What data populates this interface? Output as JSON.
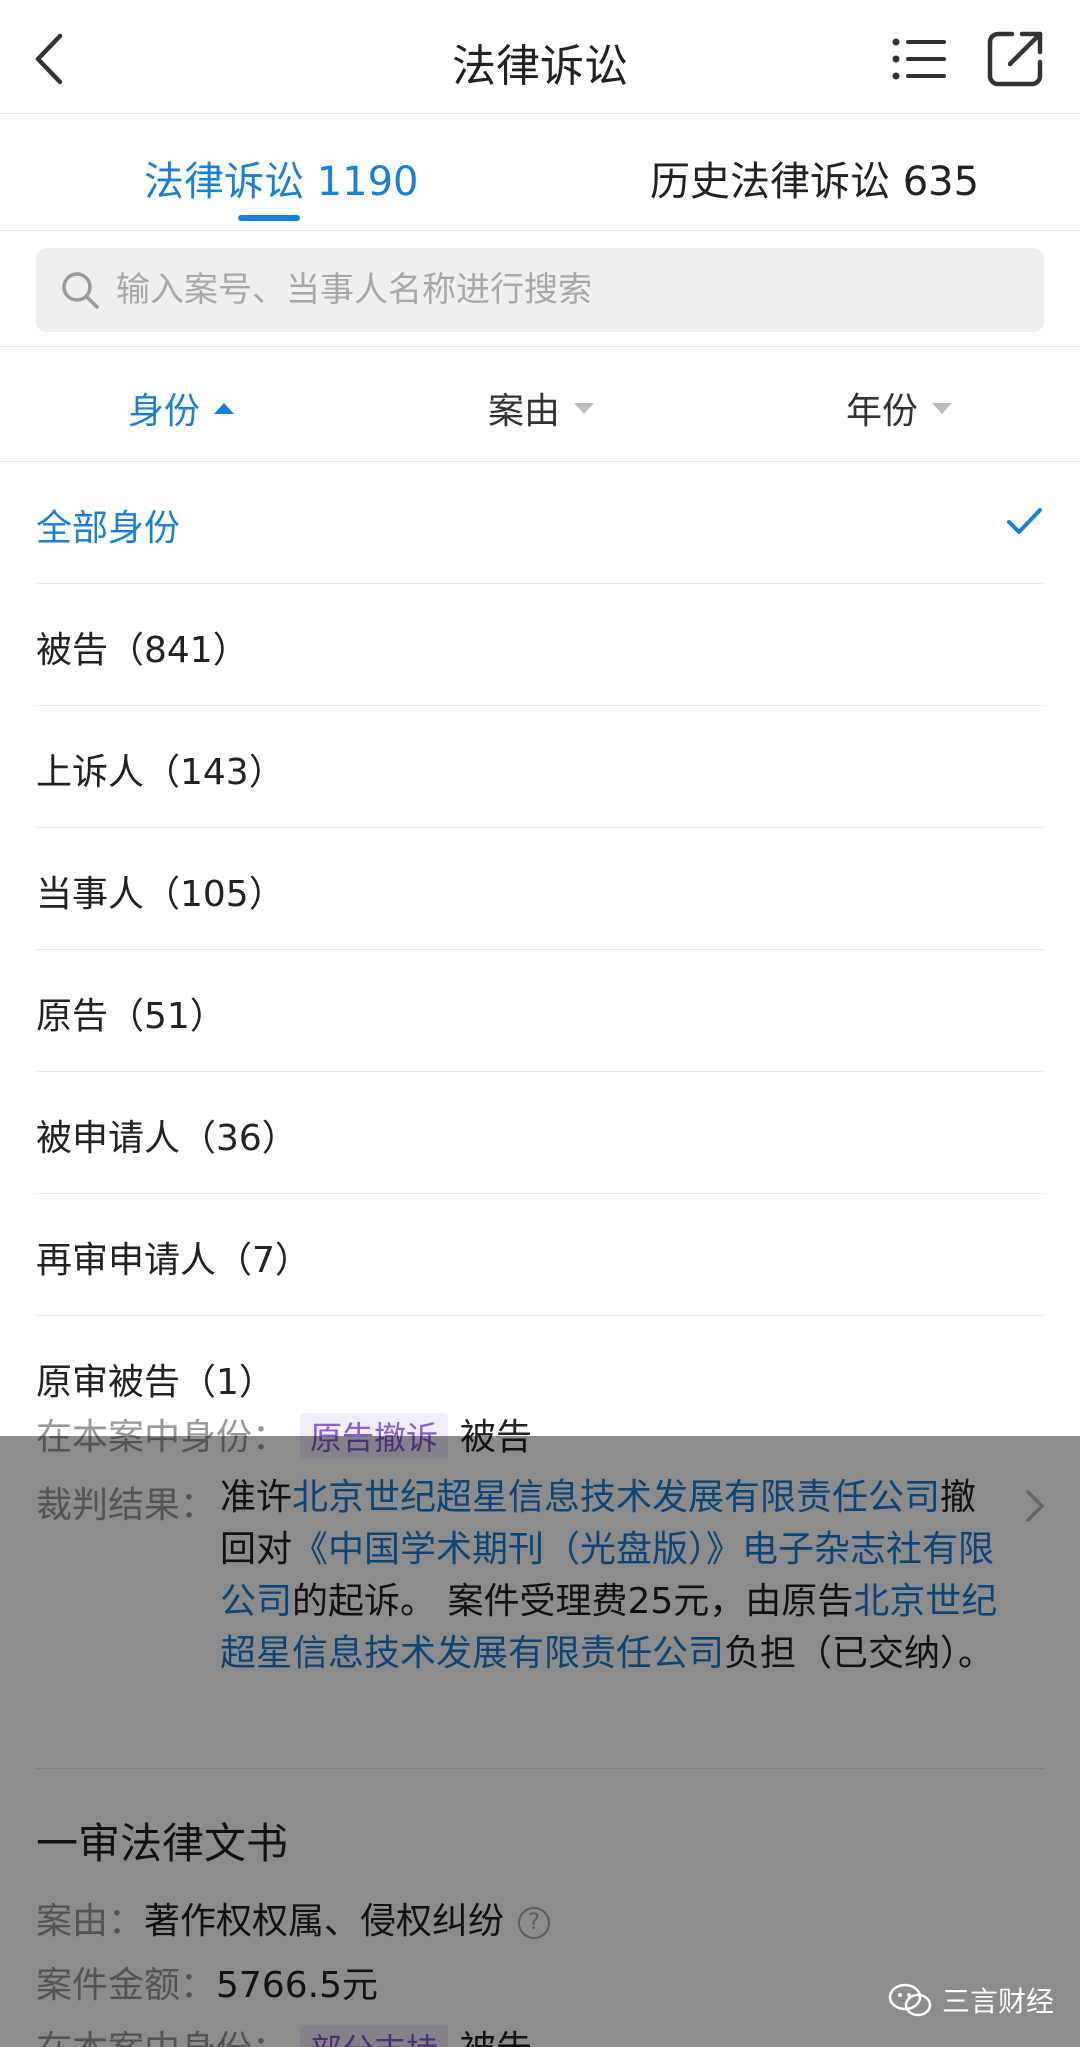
{
  "header": {
    "title": "法律诉讼"
  },
  "tabs": [
    {
      "label": "法律诉讼 1190",
      "active": true
    },
    {
      "label": "历史法律诉讼 635",
      "active": false
    }
  ],
  "search": {
    "placeholder": "输入案号、当事人名称进行搜索"
  },
  "filters": [
    {
      "label": "身份",
      "active": true
    },
    {
      "label": "案由",
      "active": false
    },
    {
      "label": "年份",
      "active": false
    }
  ],
  "dropdown": {
    "items": [
      {
        "label": "全部身份",
        "selected": true
      },
      {
        "label": "被告（841）",
        "selected": false
      },
      {
        "label": "上诉人（143）",
        "selected": false
      },
      {
        "label": "当事人（105）",
        "selected": false
      },
      {
        "label": "原告（51）",
        "selected": false
      },
      {
        "label": "被申请人（36）",
        "selected": false
      },
      {
        "label": "再审申请人（7）",
        "selected": false
      },
      {
        "label": "原审被告（1）",
        "selected": false
      }
    ]
  },
  "background": {
    "role_row_1": {
      "label": "在本案中身份：",
      "tag": "原告撤诉",
      "value": "被告"
    },
    "judgment": {
      "label": "裁判结果：",
      "t1": "准许",
      "l1": "北京世纪超星信息技术发展有限责任公司",
      "t2": "撤回对",
      "l2": "《中国学术期刊（光盘版）》电子杂志社有限公司",
      "t3": "的起诉。 案件受理费25元，由原告",
      "l3": "北京世纪超星信息技术发展有限责任公司",
      "t4": "负担（已交纳）。"
    },
    "section_title": "一审法律文书",
    "cause": {
      "label": "案由：",
      "value": "著作权权属、侵权纠纷",
      "help": "?"
    },
    "amount": {
      "label": "案件金额：",
      "value": "5766.5元"
    },
    "role_row_2": {
      "label": "在本案中身份：",
      "tag": "部分支持",
      "value": "被告"
    }
  },
  "watermark": {
    "text": "三言财经",
    "icon": "wechat-icon"
  },
  "colors": {
    "accent": "#1a7fd9",
    "overlay": "rgba(0,0,0,0.45)",
    "tag_bg": "#f3ecfb",
    "tag_text": "#8a5cd1"
  }
}
